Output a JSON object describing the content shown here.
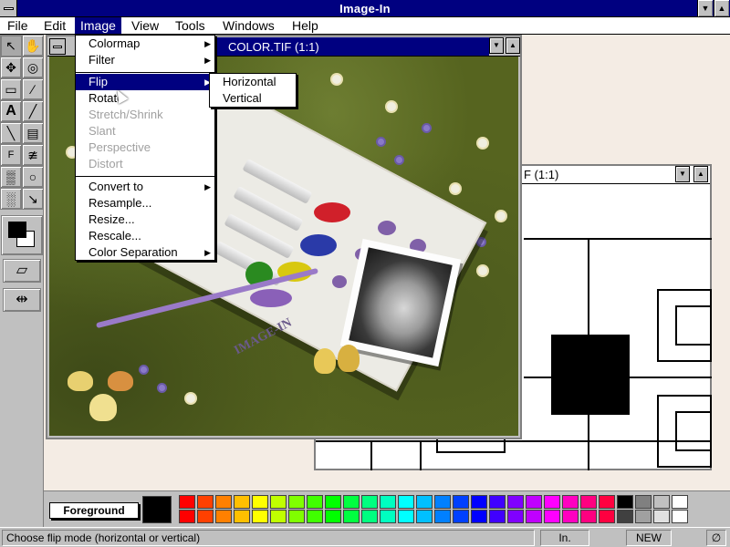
{
  "app": {
    "title": "Image-In"
  },
  "titlebar": {
    "minimize_glyph": "▼",
    "maximize_glyph": "▲"
  },
  "menubar": {
    "items": [
      "File",
      "Edit",
      "Image",
      "View",
      "Tools",
      "Windows",
      "Help"
    ],
    "active": "Image"
  },
  "image_menu": {
    "groups": [
      [
        "Colormap",
        "Filter"
      ],
      [
        "Flip",
        "Rotate",
        "Stretch/Shrink",
        "Slant",
        "Perspective",
        "Distort"
      ],
      [
        "Convert to",
        "Resample...",
        "Resize...",
        "Rescale...",
        "Color Separation"
      ]
    ],
    "items": {
      "colormap": "Colormap",
      "filter": "Filter",
      "flip": "Flip",
      "rotate": "Rotate",
      "stretch_shrink": "Stretch/Shrink",
      "slant": "Slant",
      "perspective": "Perspective",
      "distort": "Distort",
      "convert_to": "Convert to",
      "resample": "Resample...",
      "resize": "Resize...",
      "rescale": "Rescale...",
      "color_separation": "Color Separation"
    },
    "disabled": [
      "Stretch/Shrink",
      "Slant",
      "Perspective",
      "Distort"
    ],
    "selected": "Flip",
    "submenu_arrow": "▶"
  },
  "flip_submenu": {
    "horizontal": "Horizontal",
    "vertical": "Vertical"
  },
  "document_window_1": {
    "title": "COLOR.TIF (1:1)",
    "logo_text": "IMAGE-IN"
  },
  "document_window_2": {
    "title_visible": "F (1:1)"
  },
  "palette": {
    "foreground_label": "Foreground",
    "foreground_color": "#000000",
    "row1": [
      "#ff0000",
      "#ff4000",
      "#ff8000",
      "#ffc000",
      "#ffff00",
      "#c0ff00",
      "#80ff00",
      "#40ff00",
      "#00ff00",
      "#00ff40",
      "#00ff80",
      "#00ffc0",
      "#00ffff",
      "#00c0ff",
      "#0080ff",
      "#0040ff",
      "#0000ff",
      "#4000ff",
      "#8000ff",
      "#c000ff",
      "#ff00ff",
      "#ff00c0",
      "#ff0080",
      "#ff0040",
      "#000000",
      "#808080",
      "#c0c0c0",
      "#ffffff"
    ],
    "row2": [
      "#ff0000",
      "#ff4000",
      "#ff8000",
      "#ffc000",
      "#ffff00",
      "#c0ff00",
      "#80ff00",
      "#40ff00",
      "#00ff00",
      "#00ff40",
      "#00ff80",
      "#00ffc0",
      "#00ffff",
      "#00c0ff",
      "#0080ff",
      "#0040ff",
      "#0000ff",
      "#4000ff",
      "#8000ff",
      "#c000ff",
      "#ff00ff",
      "#ff00c0",
      "#ff0080",
      "#ff0040",
      "#404040",
      "#a0a0a0",
      "#e0e0e0",
      "#ffffff"
    ]
  },
  "statusbar": {
    "message": "Choose flip mode (horizontal or vertical)",
    "mode": "In.",
    "state": "NEW",
    "extra": "∅"
  },
  "toolbox": {
    "tools": [
      "arrow-select-icon",
      "hand-icon",
      "move-icon",
      "zoom-icon",
      "eraser-icon",
      "pencil-icon",
      "text-icon",
      "brush-icon",
      "line-icon",
      "bucket-icon",
      "fx-icon",
      "smudge-icon",
      "airbrush-icon",
      "lasso-icon",
      "hatch-icon",
      "eyedropper-icon"
    ],
    "glyphs": [
      "↖",
      "✋",
      "✥",
      "◎",
      "▭",
      "∕",
      "A",
      "╱",
      "╲",
      "▤",
      "F",
      "≇",
      "▒",
      "○",
      "░",
      "↘"
    ]
  }
}
